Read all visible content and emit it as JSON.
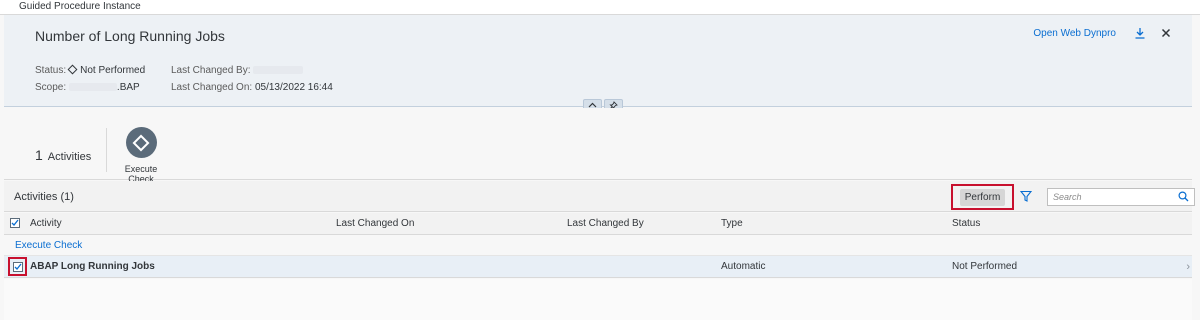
{
  "window": {
    "title": "Guided Procedure Instance"
  },
  "header": {
    "title": "Number of Long Running Jobs",
    "actions": {
      "open_web_dynpro": "Open Web Dynpro",
      "download_icon": "download-icon",
      "close_icon": "close-icon"
    },
    "status_label": "Status:",
    "status_value": "Not Performed",
    "scope_label": "Scope:",
    "scope_value": ".BAP",
    "last_changed_by_label": "Last Changed By:",
    "last_changed_on_label": "Last Changed On:",
    "last_changed_on_value": "05/13/2022 16:44"
  },
  "anchor": {
    "count": "1",
    "count_label": "Activities",
    "steps": [
      {
        "label": "Execute Check",
        "icon": "diamond-icon"
      }
    ]
  },
  "table": {
    "title": "Activities (1)",
    "perform_label": "Perform",
    "search_placeholder": "Search",
    "columns": [
      "Activity",
      "Last Changed On",
      "Last Changed By",
      "Type",
      "Status"
    ],
    "group_label": "Execute Check",
    "rows": [
      {
        "activity": "ABAP Long Running Jobs",
        "last_changed_on": "",
        "last_changed_by": "",
        "type": "Automatic",
        "status": "Not Performed",
        "selected": true
      }
    ]
  },
  "colors": {
    "accent": "#0a6ed1",
    "highlight_box": "#c8102e",
    "header_bg": "#edf1f5"
  }
}
